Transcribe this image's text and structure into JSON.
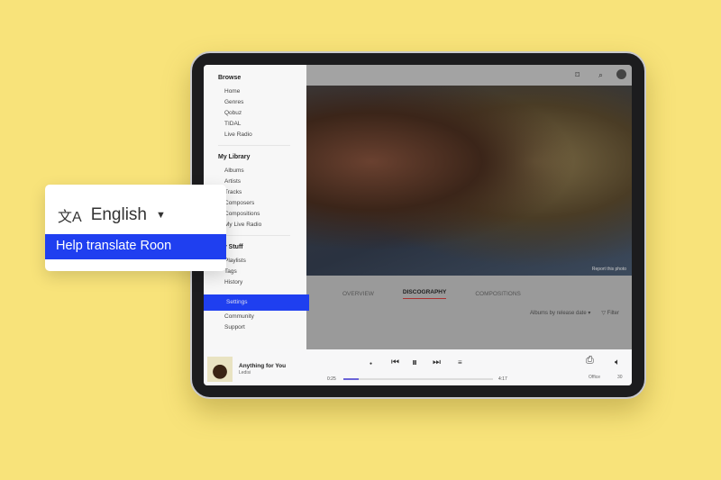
{
  "popup": {
    "language": "English",
    "help_label": "Help translate Roon",
    "translate_icon": "translate-icon",
    "dropdown_icon": "caret-down-icon"
  },
  "sidebar": {
    "browse": {
      "title": "Browse",
      "items": [
        "Home",
        "Genres",
        "Qobuz",
        "TIDAL",
        "Live Radio"
      ]
    },
    "library": {
      "title": "My Library",
      "items": [
        "Albums",
        "Artists",
        "Tracks",
        "Composers",
        "Compositions",
        "My Live Radio"
      ]
    },
    "stuff": {
      "title": "My Stuff",
      "items": [
        "Playlists",
        "Tags",
        "History"
      ]
    },
    "settings": "Settings",
    "community": "Community",
    "support": "Support"
  },
  "header": {
    "report_photo": "Report this photo"
  },
  "tabs": [
    "OVERVIEW",
    "DISCOGRAPHY",
    "COMPOSITIONS"
  ],
  "sort": {
    "label": "Albums by release date",
    "filter": "Filter"
  },
  "player": {
    "title": "Anything for You",
    "artist": "Ledisi",
    "elapsed": "0:25",
    "total": "4:17",
    "progress": 0.1,
    "zone": "Office",
    "volume": "30"
  },
  "colors": {
    "accent": "#1f3ff0",
    "background": "#f8e37a"
  }
}
